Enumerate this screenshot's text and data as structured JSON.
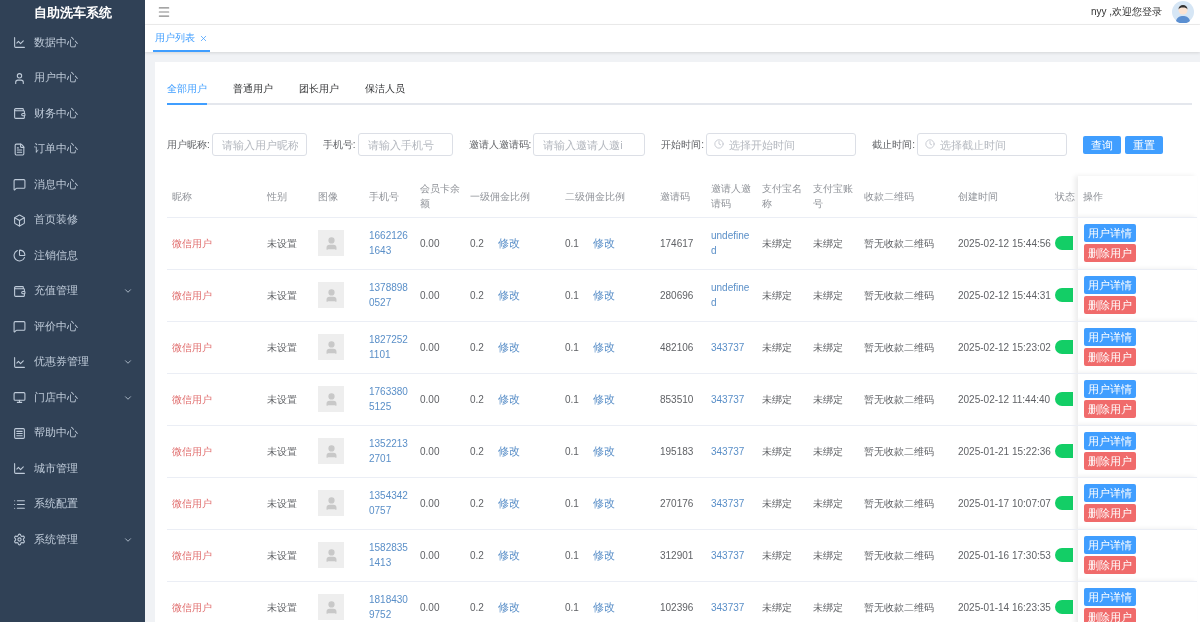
{
  "sidebar": {
    "title": "自助洗车系统",
    "items": [
      {
        "label": "数据中心",
        "expandable": false
      },
      {
        "label": "用户中心",
        "expandable": false
      },
      {
        "label": "财务中心",
        "expandable": false
      },
      {
        "label": "订单中心",
        "expandable": false
      },
      {
        "label": "消息中心",
        "expandable": false
      },
      {
        "label": "首页装修",
        "expandable": false
      },
      {
        "label": "注销信息",
        "expandable": false
      },
      {
        "label": "充值管理",
        "expandable": true
      },
      {
        "label": "评价中心",
        "expandable": false
      },
      {
        "label": "优惠券管理",
        "expandable": true
      },
      {
        "label": "门店中心",
        "expandable": true
      },
      {
        "label": "帮助中心",
        "expandable": false
      },
      {
        "label": "城市管理",
        "expandable": false
      },
      {
        "label": "系统配置",
        "expandable": false
      },
      {
        "label": "系统管理",
        "expandable": true
      }
    ]
  },
  "header": {
    "welcome": "nyy ,欢迎您登录"
  },
  "page_tabs": [
    {
      "label": "用户列表",
      "selected": true
    }
  ],
  "user_tabs": [
    {
      "label": "全部用户",
      "selected": true
    },
    {
      "label": "普通用户",
      "selected": false
    },
    {
      "label": "团长用户",
      "selected": false
    },
    {
      "label": "保洁人员",
      "selected": false
    }
  ],
  "filters": [
    {
      "label": "用户昵称:",
      "placeholder": "请输入用户昵称",
      "kind": "text"
    },
    {
      "label": "手机号:",
      "placeholder": "请输入手机号",
      "kind": "text"
    },
    {
      "label": "邀请人邀请码:",
      "placeholder": "请输入邀请人邀i",
      "kind": "text"
    },
    {
      "label": "开始时间:",
      "placeholder": "选择开始时间",
      "kind": "time"
    },
    {
      "label": "截止时间:",
      "placeholder": "选择截止时间",
      "kind": "time"
    }
  ],
  "filter_buttons": [
    "查询",
    "重置"
  ],
  "table": {
    "columns": [
      "昵称",
      "性别",
      "图像",
      "手机号",
      "会员卡余额",
      "一级佣金比例",
      "二级佣金比例",
      "邀请码",
      "邀请人邀请码",
      "支付宝名称",
      "支付宝账号",
      "收款二维码",
      "创建时间",
      "状态",
      "操作"
    ],
    "rows": [
      {
        "nickname": "微信用户",
        "gender": "未设置",
        "phone": "16621261643",
        "balance": "0.00",
        "rate1": "0.2",
        "edit1": "修改",
        "rate2": "0.1",
        "edit2": "修改",
        "code": "174617",
        "inviter_code": "undefined",
        "alipay_name": "未绑定",
        "alipay_account": "未绑定",
        "qr": "暂无收款二维码",
        "created": "2025-02-12 15:44:56",
        "on": true,
        "detail": "用户详情",
        "delete": "删除用户"
      },
      {
        "nickname": "微信用户",
        "gender": "未设置",
        "phone": "13788980527",
        "balance": "0.00",
        "rate1": "0.2",
        "edit1": "修改",
        "rate2": "0.1",
        "edit2": "修改",
        "code": "280696",
        "inviter_code": "undefined",
        "alipay_name": "未绑定",
        "alipay_account": "未绑定",
        "qr": "暂无收款二维码",
        "created": "2025-02-12 15:44:31",
        "on": true,
        "detail": "用户详情",
        "delete": "删除用户"
      },
      {
        "nickname": "微信用户",
        "gender": "未设置",
        "phone": "18272521101",
        "balance": "0.00",
        "rate1": "0.2",
        "edit1": "修改",
        "rate2": "0.1",
        "edit2": "修改",
        "code": "482106",
        "inviter_code": "343737",
        "alipay_name": "未绑定",
        "alipay_account": "未绑定",
        "qr": "暂无收款二维码",
        "created": "2025-02-12 15:23:02",
        "on": true,
        "detail": "用户详情",
        "delete": "删除用户"
      },
      {
        "nickname": "微信用户",
        "gender": "未设置",
        "phone": "17633805125",
        "balance": "0.00",
        "rate1": "0.2",
        "edit1": "修改",
        "rate2": "0.1",
        "edit2": "修改",
        "code": "853510",
        "inviter_code": "343737",
        "alipay_name": "未绑定",
        "alipay_account": "未绑定",
        "qr": "暂无收款二维码",
        "created": "2025-02-12 11:44:40",
        "on": true,
        "detail": "用户详情",
        "delete": "删除用户"
      },
      {
        "nickname": "微信用户",
        "gender": "未设置",
        "phone": "13522132701",
        "balance": "0.00",
        "rate1": "0.2",
        "edit1": "修改",
        "rate2": "0.1",
        "edit2": "修改",
        "code": "195183",
        "inviter_code": "343737",
        "alipay_name": "未绑定",
        "alipay_account": "未绑定",
        "qr": "暂无收款二维码",
        "created": "2025-01-21 15:22:36",
        "on": true,
        "detail": "用户详情",
        "delete": "删除用户"
      },
      {
        "nickname": "微信用户",
        "gender": "未设置",
        "phone": "13543420757",
        "balance": "0.00",
        "rate1": "0.2",
        "edit1": "修改",
        "rate2": "0.1",
        "edit2": "修改",
        "code": "270176",
        "inviter_code": "343737",
        "alipay_name": "未绑定",
        "alipay_account": "未绑定",
        "qr": "暂无收款二维码",
        "created": "2025-01-17 10:07:07",
        "on": true,
        "detail": "用户详情",
        "delete": "删除用户"
      },
      {
        "nickname": "微信用户",
        "gender": "未设置",
        "phone": "15828351413",
        "balance": "0.00",
        "rate1": "0.2",
        "edit1": "修改",
        "rate2": "0.1",
        "edit2": "修改",
        "code": "312901",
        "inviter_code": "343737",
        "alipay_name": "未绑定",
        "alipay_account": "未绑定",
        "qr": "暂无收款二维码",
        "created": "2025-01-16 17:30:53",
        "on": true,
        "detail": "用户详情",
        "delete": "删除用户"
      },
      {
        "nickname": "微信用户",
        "gender": "未设置",
        "phone": "18184309752",
        "balance": "0.00",
        "rate1": "0.2",
        "edit1": "修改",
        "rate2": "0.1",
        "edit2": "修改",
        "code": "102396",
        "inviter_code": "343737",
        "alipay_name": "未绑定",
        "alipay_account": "未绑定",
        "qr": "暂无收款二维码",
        "created": "2025-01-14 16:23:35",
        "on": true,
        "detail": "用户详情",
        "delete": "删除用户"
      }
    ]
  }
}
